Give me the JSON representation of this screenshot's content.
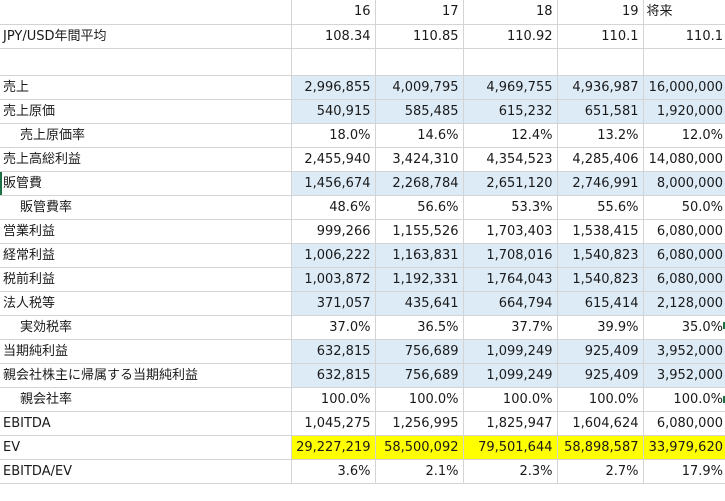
{
  "header": {
    "label": "",
    "years": [
      "16",
      "17",
      "18",
      "19",
      "将来"
    ]
  },
  "rows": [
    {
      "key": "fx",
      "label": "JPY/USD年間平均",
      "indent": false,
      "fill": "none",
      "values": [
        "108.34",
        "110.85",
        "110.92",
        "110.1",
        "110.1"
      ]
    },
    {
      "key": "blank",
      "label": "",
      "indent": false,
      "fill": "none",
      "values": [
        "",
        "",
        "",
        "",
        ""
      ]
    },
    {
      "key": "sales",
      "label": "売上",
      "indent": false,
      "fill": "blue",
      "values": [
        "2,996,855",
        "4,009,795",
        "4,969,755",
        "4,936,987",
        "16,000,000"
      ]
    },
    {
      "key": "cogs",
      "label": "売上原価",
      "indent": false,
      "fill": "blue",
      "values": [
        "540,915",
        "585,485",
        "615,232",
        "651,581",
        "1,920,000"
      ]
    },
    {
      "key": "cogs_rate",
      "label": "売上原価率",
      "indent": true,
      "fill": "none",
      "values": [
        "18.0%",
        "14.6%",
        "12.4%",
        "13.2%",
        "12.0%"
      ]
    },
    {
      "key": "gross_profit",
      "label": "売上高総利益",
      "indent": false,
      "fill": "none",
      "values": [
        "2,455,940",
        "3,424,310",
        "4,354,523",
        "4,285,406",
        "14,080,000"
      ]
    },
    {
      "key": "sga",
      "label": "販管費",
      "indent": false,
      "fill": "blue",
      "values": [
        "1,456,674",
        "2,268,784",
        "2,651,120",
        "2,746,991",
        "8,000,000"
      ]
    },
    {
      "key": "sga_rate",
      "label": "販管費率",
      "indent": true,
      "fill": "none",
      "values": [
        "48.6%",
        "56.6%",
        "53.3%",
        "55.6%",
        "50.0%"
      ]
    },
    {
      "key": "operating_profit",
      "label": "営業利益",
      "indent": false,
      "fill": "none",
      "values": [
        "999,266",
        "1,155,526",
        "1,703,403",
        "1,538,415",
        "6,080,000"
      ]
    },
    {
      "key": "ordinary_profit",
      "label": "経常利益",
      "indent": false,
      "fill": "blue",
      "values": [
        "1,006,222",
        "1,163,831",
        "1,708,016",
        "1,540,823",
        "6,080,000"
      ]
    },
    {
      "key": "pretax_profit",
      "label": "税前利益",
      "indent": false,
      "fill": "blue",
      "values": [
        "1,003,872",
        "1,192,331",
        "1,764,043",
        "1,540,823",
        "6,080,000"
      ]
    },
    {
      "key": "corp_tax",
      "label": "法人税等",
      "indent": false,
      "fill": "blue",
      "values": [
        "371,057",
        "435,641",
        "664,794",
        "615,414",
        "2,128,000"
      ]
    },
    {
      "key": "eff_tax_rate",
      "label": "実効税率",
      "indent": true,
      "fill": "none",
      "values": [
        "37.0%",
        "36.5%",
        "37.7%",
        "39.9%",
        "35.0%"
      ]
    },
    {
      "key": "net_income",
      "label": "当期純利益",
      "indent": false,
      "fill": "blue",
      "values": [
        "632,815",
        "756,689",
        "1,099,249",
        "925,409",
        "3,952,000"
      ]
    },
    {
      "key": "net_income_parent",
      "label": "親会社株主に帰属する当期純利益",
      "indent": false,
      "fill": "blue",
      "values": [
        "632,815",
        "756,689",
        "1,099,249",
        "925,409",
        "3,952,000"
      ]
    },
    {
      "key": "parent_rate",
      "label": "親会社率",
      "indent": true,
      "fill": "none",
      "values": [
        "100.0%",
        "100.0%",
        "100.0%",
        "100.0%",
        "100.0%"
      ]
    },
    {
      "key": "ebitda",
      "label": "EBITDA",
      "indent": false,
      "fill": "none",
      "values": [
        "1,045,275",
        "1,256,995",
        "1,825,947",
        "1,604,624",
        "6,080,000"
      ]
    },
    {
      "key": "ev",
      "label": "EV",
      "indent": false,
      "fill": "yellow",
      "values": [
        "29,227,219",
        "58,500,092",
        "79,501,644",
        "58,898,587",
        "33,979,620"
      ]
    },
    {
      "key": "ebitda_ev",
      "label": "EBITDA/EV",
      "indent": false,
      "fill": "none",
      "values": [
        "3.6%",
        "2.1%",
        "2.3%",
        "2.7%",
        "17.9%"
      ]
    }
  ],
  "colors": {
    "blue_fill": "#ddebf7",
    "yellow_fill": "#ffff00",
    "grid": "#d4d4d4",
    "marker": "#1e7145"
  }
}
